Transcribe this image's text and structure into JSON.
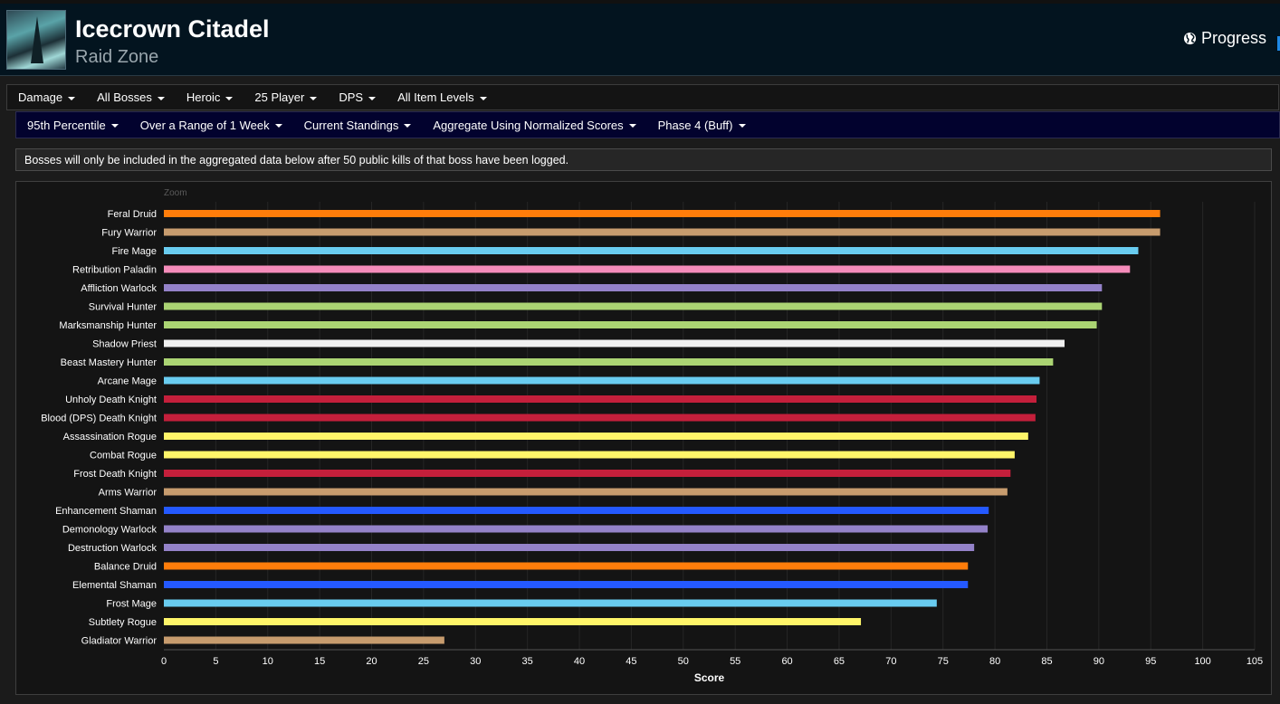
{
  "header": {
    "title": "Icecrown Citadel",
    "subtitle": "Raid Zone",
    "progress_label": "Progress",
    "icon": "icecrown-citadel-zone-icon"
  },
  "filters_primary": [
    {
      "label": "Damage"
    },
    {
      "label": "All Bosses"
    },
    {
      "label": "Heroic"
    },
    {
      "label": "25 Player"
    },
    {
      "label": "DPS"
    },
    {
      "label": "All Item Levels"
    }
  ],
  "filters_secondary": [
    {
      "label": "95th Percentile"
    },
    {
      "label": "Over a Range of 1 Week"
    },
    {
      "label": "Current Standings"
    },
    {
      "label": "Aggregate Using Normalized Scores"
    },
    {
      "label": "Phase 4 (Buff)"
    }
  ],
  "notice": "Bosses will only be included in the aggregated data below after 50 public kills of that boss have been logged.",
  "chart_data": {
    "type": "bar",
    "orientation": "horizontal",
    "zoom_label": "Zoom",
    "xlabel": "Score",
    "xlim": [
      0,
      105
    ],
    "xticks": [
      0,
      5,
      10,
      15,
      20,
      25,
      30,
      35,
      40,
      45,
      50,
      55,
      60,
      65,
      70,
      75,
      80,
      85,
      90,
      95,
      100,
      105
    ],
    "grid": true,
    "categories": [
      "Feral Druid",
      "Fury Warrior",
      "Fire Mage",
      "Retribution Paladin",
      "Affliction Warlock",
      "Survival Hunter",
      "Marksmanship Hunter",
      "Shadow Priest",
      "Beast Mastery Hunter",
      "Arcane Mage",
      "Unholy Death Knight",
      "Blood (DPS) Death Knight",
      "Assassination Rogue",
      "Combat Rogue",
      "Frost Death Knight",
      "Arms Warrior",
      "Enhancement Shaman",
      "Demonology Warlock",
      "Destruction Warlock",
      "Balance Druid",
      "Elemental Shaman",
      "Frost Mage",
      "Subtlety Rogue",
      "Gladiator Warrior"
    ],
    "values": [
      95.9,
      95.9,
      93.8,
      93.0,
      90.3,
      90.3,
      89.8,
      86.7,
      85.6,
      84.3,
      84.0,
      83.9,
      83.2,
      81.9,
      81.5,
      81.2,
      79.4,
      79.3,
      78.0,
      77.4,
      77.4,
      74.4,
      67.1,
      27.0
    ],
    "colors": [
      "#ff7d0a",
      "#c79c6e",
      "#69ccf0",
      "#f58cba",
      "#9482c9",
      "#abd473",
      "#abd473",
      "#f0f0f0",
      "#abd473",
      "#69ccf0",
      "#c41f3b",
      "#c41f3b",
      "#fff569",
      "#fff569",
      "#c41f3b",
      "#c79c6e",
      "#2459ff",
      "#9482c9",
      "#9482c9",
      "#ff7d0a",
      "#2459ff",
      "#69ccf0",
      "#fff569",
      "#c79c6e"
    ]
  }
}
